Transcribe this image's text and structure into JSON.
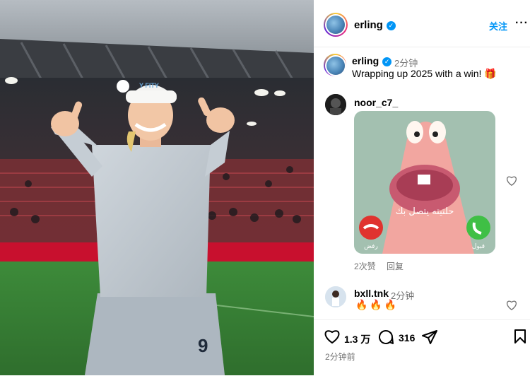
{
  "post": {
    "author": "erling",
    "follow_label": "关注",
    "more_label": "···",
    "caption": {
      "author": "erling",
      "time": "2分钟",
      "text": "Wrapping up 2025 with a win! 🎁"
    },
    "photo": {
      "shirt_text": "Y FITY",
      "shorts_number": "9"
    },
    "comments": [
      {
        "author": "noor_c7_",
        "sticker": {
          "text": "حلتيته يتصل بك",
          "decline_label": "رفض",
          "accept_label": "قبول"
        },
        "likes_label": "2次赞",
        "reply_label": "回复"
      },
      {
        "author": "bxll.tnk",
        "time": "2分钟",
        "text": "🔥🔥🔥"
      }
    ],
    "likes_count": "1.3 万",
    "comments_count": "316",
    "posted_ago": "2分钟前"
  },
  "colors": {
    "accent": "#0095f6",
    "muted": "#737373",
    "decline": "#e0332f",
    "accept": "#3fbf45",
    "pitch": "#3f8f3c"
  },
  "icons": [
    "verified-badge-icon",
    "heart-icon",
    "comment-bubble-icon",
    "share-send-icon",
    "bookmark-icon",
    "more-icon",
    "gift-icon",
    "fire-icon"
  ]
}
